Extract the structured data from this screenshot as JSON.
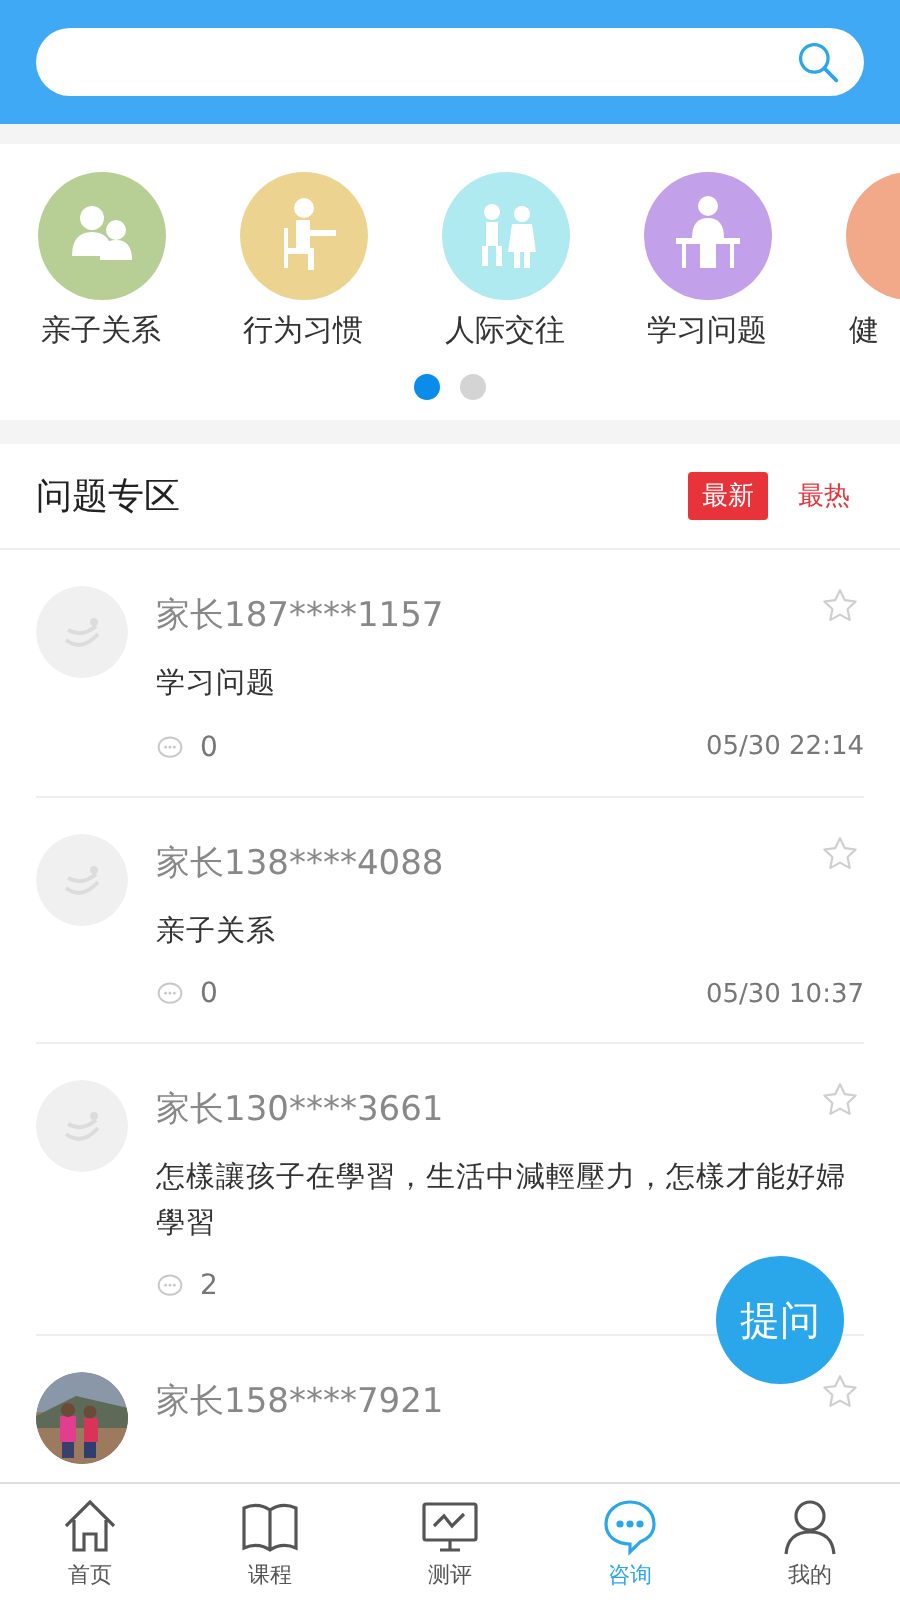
{
  "categories": [
    {
      "label": "亲子关系",
      "color": "#b7cf94",
      "kind": "family"
    },
    {
      "label": "行为习惯",
      "color": "#ecd38f",
      "kind": "desk"
    },
    {
      "label": "人际交往",
      "color": "#aeeaf0",
      "kind": "kids"
    },
    {
      "label": "学习问题",
      "color": "#c3a1ea",
      "kind": "reading"
    },
    {
      "label": "健",
      "color": "#f2a98a",
      "kind": "person"
    }
  ],
  "pager": [
    {
      "selected": true
    },
    {
      "selected": false
    }
  ],
  "section": {
    "title": "问题专区",
    "tabs": [
      {
        "label": "最新",
        "selected": true
      },
      {
        "label": "最热",
        "selected": false
      }
    ]
  },
  "posts": [
    {
      "author": "家长187****1157",
      "text": "学习问题",
      "comments": "0",
      "time": "05/30 22:14"
    },
    {
      "author": "家长138****4088",
      "text": "亲子关系",
      "comments": "0",
      "time": "05/30 10:37"
    },
    {
      "author": "家长130****3661",
      "text": "怎樣讓孩子在學習，生活中減輕壓力，怎樣才能好婦學習",
      "comments": "2"
    },
    {
      "author": "家长158****7921",
      "kind": "picture"
    }
  ],
  "fab": "提问",
  "nav": [
    {
      "label": "首页",
      "selected": false
    },
    {
      "label": "课程",
      "selected": false
    },
    {
      "label": "测评",
      "selected": false
    },
    {
      "label": "咨询",
      "selected": true
    },
    {
      "label": "我的",
      "selected": false
    }
  ]
}
